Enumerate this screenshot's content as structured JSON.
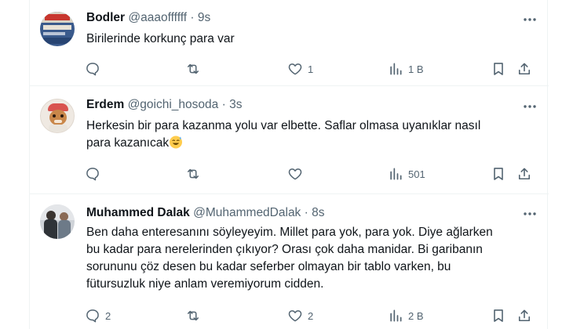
{
  "tweets": [
    {
      "name": "Bodler",
      "handle": "@aaaoffffff",
      "separator": "·",
      "time": "9s",
      "text": "Birilerinde korkunç para var",
      "actions": {
        "replies": "",
        "retweets": "",
        "likes": "1",
        "views": "1 B"
      }
    },
    {
      "name": "Erdem",
      "handle": "@goichi_hosoda",
      "separator": "·",
      "time": "3s",
      "text_line1": "Herkesin bir para kazanma yolu var elbette. Saflar olmasa uyanıklar nasıl",
      "text_line2": "para kazanıcak",
      "actions": {
        "replies": "",
        "retweets": "",
        "likes": "",
        "views": "501"
      }
    },
    {
      "name": "Muhammed Dalak",
      "handle": "@MuhammedDalak",
      "separator": "·",
      "time": "8s",
      "text_lines": [
        "Ben daha enteresanını söyleyeyim. Millet para yok, para yok. Diye ağlarken",
        "bu kadar para nerelerinden çıkıyor? Orası çok daha manidar. Bi garibanın",
        "sorununu çöz desen bu kadar seferber olmayan bir tablo varken, bu",
        "fütursuzluk niye anlam veremiyorum cidden."
      ],
      "actions": {
        "replies": "2",
        "retweets": "",
        "likes": "2",
        "views": "2 B"
      }
    }
  ],
  "icons": {
    "more": "more-horizontal-icon",
    "reply": "reply-bubble-icon",
    "retweet": "retweet-arrows-icon",
    "like": "heart-icon",
    "views": "analytics-bars-icon",
    "bookmark": "bookmark-icon",
    "share": "share-upload-icon",
    "emoji": "sweat-smile-emoji"
  },
  "colors": {
    "text": "#0f1419",
    "secondary": "#536471",
    "border": "#eff3f4"
  }
}
